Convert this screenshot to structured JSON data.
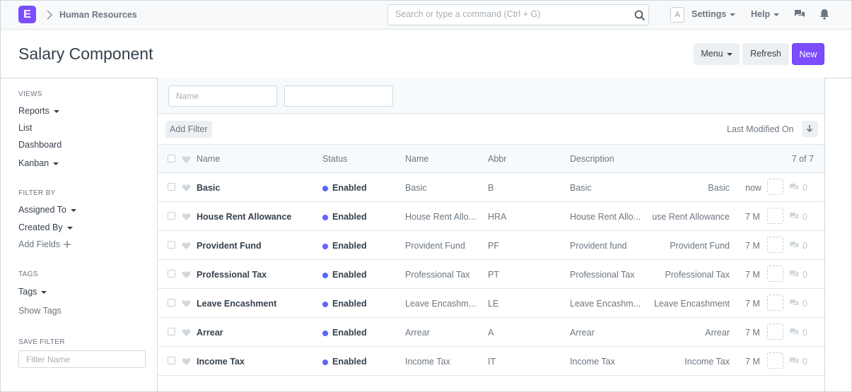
{
  "navbar": {
    "logo": "E",
    "breadcrumb": "Human Resources",
    "search_placeholder": "Search or type a command (Ctrl + G)",
    "avatar": "A",
    "settings": "Settings",
    "help": "Help"
  },
  "page": {
    "title": "Salary Component",
    "menu": "Menu",
    "refresh": "Refresh",
    "new": "New"
  },
  "sidebar": {
    "views_label": "VIEWS",
    "reports": "Reports",
    "list": "List",
    "dashboard": "Dashboard",
    "kanban": "Kanban",
    "filter_by_label": "FILTER BY",
    "assigned_to": "Assigned To",
    "created_by": "Created By",
    "add_fields": "Add Fields",
    "tags_label": "TAGS",
    "tags": "Tags",
    "show_tags": "Show Tags",
    "save_filter_label": "SAVE FILTER",
    "filter_name_placeholder": "Filter Name"
  },
  "filters": {
    "name_placeholder": "Name",
    "second_placeholder": "",
    "add_filter": "Add Filter",
    "sort_label": "Last Modified On"
  },
  "list": {
    "headers": {
      "name": "Name",
      "status": "Status",
      "name2": "Name",
      "abbr": "Abbr",
      "description": "Description",
      "count": "7 of 7"
    },
    "rows": [
      {
        "name": "Basic",
        "status": "Enabled",
        "component_name": "Basic",
        "abbr": "B",
        "description": "Basic",
        "description2": "Basic",
        "modified": "now",
        "comments": "0"
      },
      {
        "name": "House Rent Allowance",
        "status": "Enabled",
        "component_name": "House Rent Allo...",
        "abbr": "HRA",
        "description": "House Rent Allo...",
        "description2": "use Rent Allowance",
        "modified": "7 M",
        "comments": "0"
      },
      {
        "name": "Provident Fund",
        "status": "Enabled",
        "component_name": "Provident Fund",
        "abbr": "PF",
        "description": "Provident fund",
        "description2": "Provident Fund",
        "modified": "7 M",
        "comments": "0"
      },
      {
        "name": "Professional Tax",
        "status": "Enabled",
        "component_name": "Professional Tax",
        "abbr": "PT",
        "description": "Professional Tax",
        "description2": "Professional Tax",
        "modified": "7 M",
        "comments": "0"
      },
      {
        "name": "Leave Encashment",
        "status": "Enabled",
        "component_name": "Leave Encashm...",
        "abbr": "LE",
        "description": "Leave Encashm...",
        "description2": "Leave Encashment",
        "modified": "7 M",
        "comments": "0"
      },
      {
        "name": "Arrear",
        "status": "Enabled",
        "component_name": "Arrear",
        "abbr": "A",
        "description": "Arrear",
        "description2": "Arrear",
        "modified": "7 M",
        "comments": "0"
      },
      {
        "name": "Income Tax",
        "status": "Enabled",
        "component_name": "Income Tax",
        "abbr": "IT",
        "description": "Income Tax",
        "description2": "Income Tax",
        "modified": "7 M",
        "comments": "0"
      }
    ]
  },
  "colors": {
    "accent": "#7c4dff",
    "status_dot": "#5e64ff"
  }
}
